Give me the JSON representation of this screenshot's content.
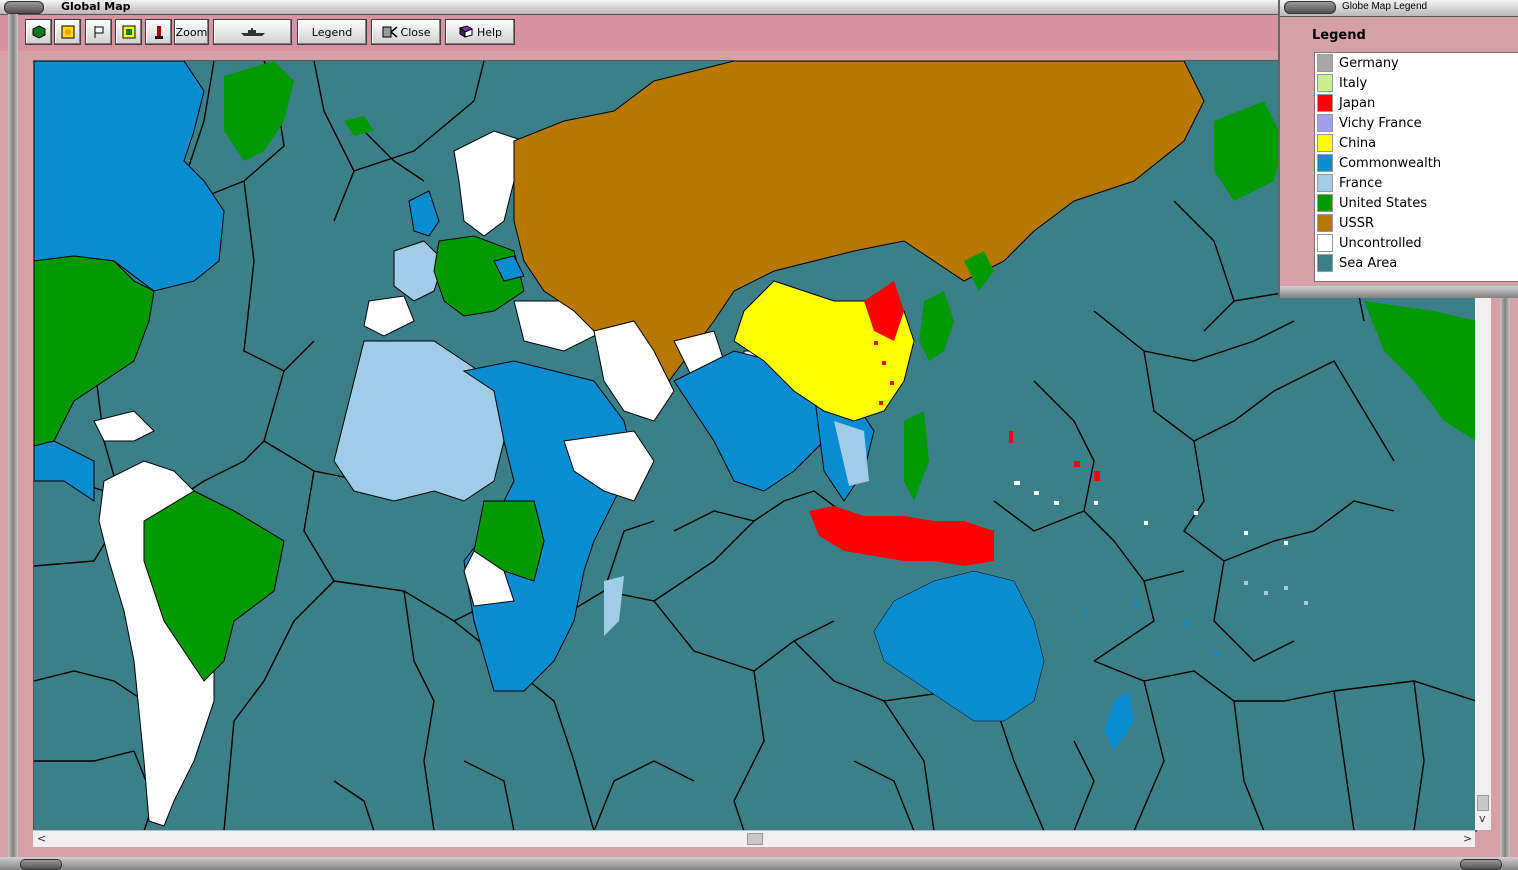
{
  "window": {
    "title": "Global Map"
  },
  "toolbar": {
    "zoom_label": "Zoom",
    "legend_label": "Legend",
    "close_label": "Close",
    "help_label": "Help"
  },
  "legend_window": {
    "title": "Globe Map Legend",
    "heading": "Legend",
    "items": [
      {
        "label": "Germany",
        "color": "#a8a8a8"
      },
      {
        "label": "Italy",
        "color": "#c8f08c"
      },
      {
        "label": "Japan",
        "color": "#ff0000"
      },
      {
        "label": "Vichy France",
        "color": "#a0a0ec"
      },
      {
        "label": "China",
        "color": "#ffff00"
      },
      {
        "label": "Commonwealth",
        "color": "#0a8cd0"
      },
      {
        "label": "France",
        "color": "#a0cce8"
      },
      {
        "label": "United States",
        "color": "#009a00"
      },
      {
        "label": "USSR",
        "color": "#b87800"
      },
      {
        "label": "Uncontrolled",
        "color": "#ffffff"
      },
      {
        "label": "Sea Area",
        "color": "#3b8088"
      }
    ]
  },
  "icons": [
    "hexagon-icon",
    "sun-icon",
    "flag-icon",
    "map-icon",
    "torch-icon",
    "ship-icon",
    "close-icon",
    "help-book-icon"
  ]
}
